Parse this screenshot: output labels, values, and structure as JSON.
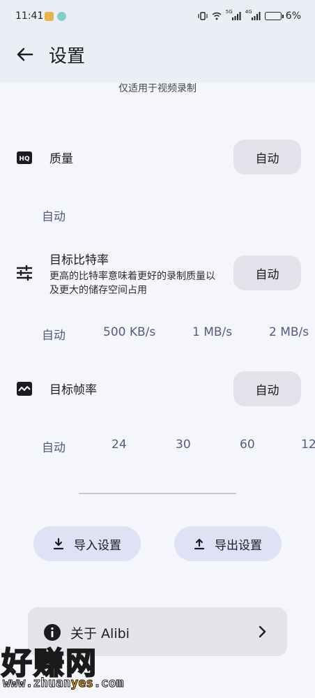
{
  "status_bar": {
    "time": "11:41",
    "battery_percent": "6%",
    "signal_labels": [
      "5G",
      "4G"
    ]
  },
  "header": {
    "title": "设置",
    "back_icon": "arrow-left-icon"
  },
  "hint": "仅适用于视频录制",
  "quality": {
    "title": "质量",
    "icon": "hq-icon",
    "button_label": "自动",
    "options": [
      "自动"
    ]
  },
  "bitrate": {
    "title": "目标比特率",
    "subtitle": "更高的比特率意味着更好的录制质量以及更大的储存空间占用",
    "icon": "tune-icon",
    "button_label": "自动",
    "options": [
      "自动",
      "500 KB/s",
      "1 MB/s",
      "2 MB/s"
    ]
  },
  "framerate": {
    "title": "目标帧率",
    "icon": "waves-icon",
    "button_label": "自动",
    "options": [
      "自动",
      "24",
      "30",
      "60",
      "12"
    ]
  },
  "actions": {
    "import_label": "导入设置",
    "export_label": "导出设置"
  },
  "about": {
    "label": "关于 Alibi",
    "icon": "info-icon"
  },
  "watermark": {
    "main": "好赚网",
    "url_prefix": "www.zhuan",
    "url_highlight": "yes",
    "url_suffix": ".com"
  },
  "colors": {
    "background": "#f5f6fb",
    "header": "#eceef5",
    "option_text": "#4f5d80",
    "pill": "#e2e3ea",
    "action_button": "#dfe1f4"
  }
}
